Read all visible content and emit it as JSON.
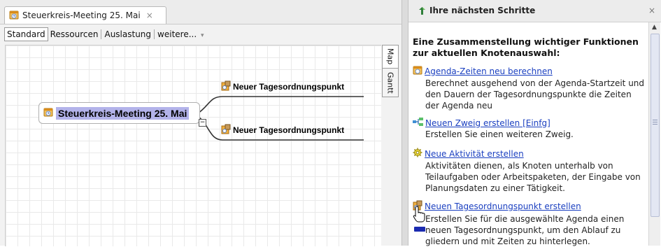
{
  "document_tab": {
    "title": "Steuerkreis-Meeting 25. Mai",
    "close_glyph": "×"
  },
  "views": [
    "Standard",
    "Ressourcen",
    "Auslastung",
    "weitere..."
  ],
  "view_dropdown_glyph": "▾",
  "side_tabs": [
    "Map",
    "Gantt"
  ],
  "mind_map": {
    "root": "Steuerkreis-Meeting 25. Mai",
    "collapse_glyph": "−",
    "children": [
      "Neuer Tagesordnungspunkt",
      "Neuer Tagesordnungspunkt"
    ],
    "root_highlight_color": "#b3b3ea"
  },
  "next_steps": {
    "title": "Ihre nächsten Schritte",
    "close_glyph": "×",
    "intro": "Eine Zusammenstellung wichtiger Funktionen zur aktuellen Knotenauswahl:",
    "actions": [
      {
        "icon": "agenda-icon",
        "link": "Agenda-Zeiten neu berechnen",
        "description": "Berechnet ausgehend von der Agenda-Startzeit und den Dauern der Tagesordnungspunkte die Zeiten der Agenda neu"
      },
      {
        "icon": "branch-icon",
        "link": "Neuen Zweig erstellen [Einfg]",
        "description": "Erstellen Sie einen weiteren Zweig."
      },
      {
        "icon": "gear-icon",
        "link": "Neue Aktivität erstellen",
        "description": "Aktivitäten dienen, als Knoten unterhalb von Teilaufgaben oder Arbeitspaketen, der Eingabe von Planungsdaten zu einer Tätigkeit."
      },
      {
        "icon": "agenda-item-icon",
        "link": "Neuen Tagesordnungspunkt erstellen",
        "description": "Erstellen Sie für die ausgewählte Agenda einen neuen Tagesordnungspunkt, um den Ablauf zu gliedern und mit Zeiten zu hinterlegen."
      }
    ],
    "link_color": "#1a3fc0",
    "scroll_up_glyph": "▲"
  }
}
